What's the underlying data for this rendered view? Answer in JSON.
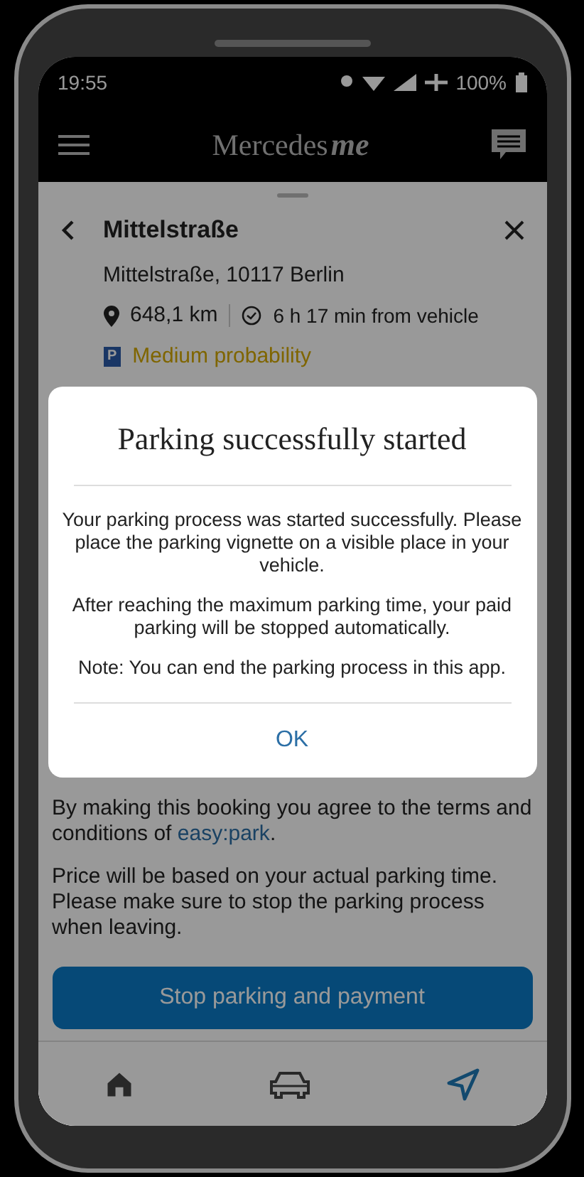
{
  "status_bar": {
    "time": "19:55",
    "battery": "100%"
  },
  "header": {
    "brand": "Mercedes",
    "brand_suffix": "me"
  },
  "location": {
    "title": "Mittelstraße",
    "address": "Mittelstraße, 10117 Berlin",
    "distance": "648,1 km",
    "duration": "6 h 17 min from vehicle",
    "probability_badge": "P",
    "probability": "Medium probability"
  },
  "terms": {
    "text_before": "By making this booking you agree to the terms and conditions of ",
    "link": "easy:park",
    "text_after": "."
  },
  "price_note": "Price will be based on your actual parking time. Please make sure to stop the parking process when leaving.",
  "stop_button": "Stop parking and payment",
  "bottom_nav": [
    {
      "kind": "home",
      "selected": false
    },
    {
      "kind": "car",
      "selected": false
    },
    {
      "kind": "navigate",
      "selected": true
    }
  ],
  "dialog": {
    "title": "Parking successfully started",
    "paragraphs": [
      "Your parking process was started successfully. Please place the parking vignette on a visible place in your vehicle.",
      "After reaching the maximum parking time, your paid parking will be stopped automatically.",
      "Note: You can end the parking process in this app."
    ],
    "button": "OK"
  }
}
